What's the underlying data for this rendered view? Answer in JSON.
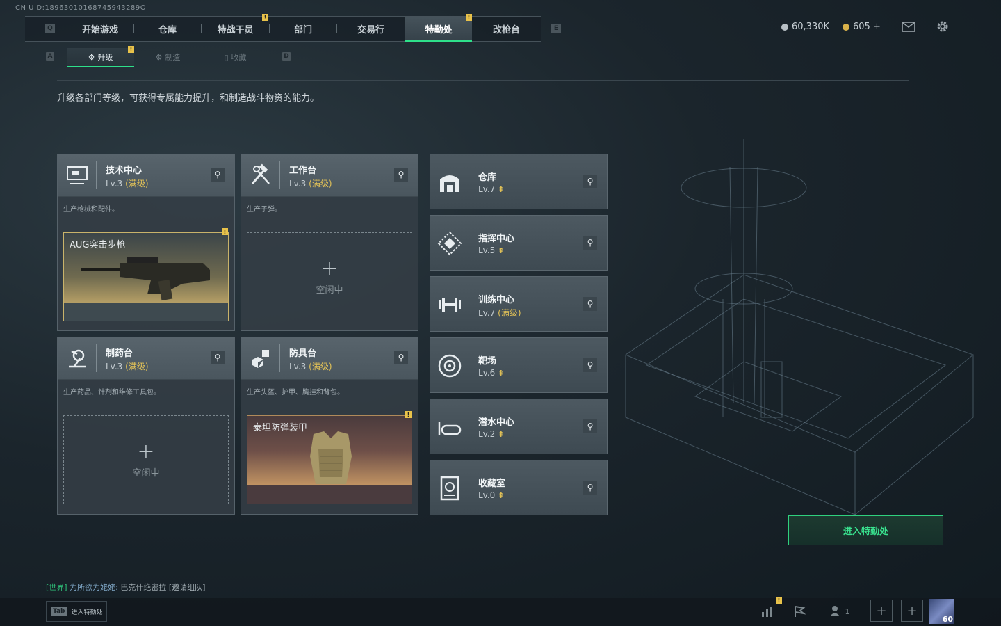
{
  "uid_text": "CN UID:18963010168745943289O",
  "nav": {
    "key_left": "Q",
    "key_right": "E",
    "tabs": [
      {
        "label": "开始游戏"
      },
      {
        "label": "仓库"
      },
      {
        "label": "特战干员"
      },
      {
        "label": "部门"
      },
      {
        "label": "交易行"
      },
      {
        "label": "特勤处"
      },
      {
        "label": "改枪台"
      }
    ]
  },
  "subnav": {
    "key_left": "A",
    "key_right": "D",
    "tabs": [
      {
        "label": "升级"
      },
      {
        "label": "制造"
      },
      {
        "label": "收藏"
      }
    ]
  },
  "currency": {
    "silver": "60,330K",
    "gold": "605 +"
  },
  "description": "升级各部门等级，可获得专属能力提升，和制造战斗物资的能力。",
  "cards": {
    "tech": {
      "name": "技术中心",
      "lv": "Lv.3",
      "max": "(满级)",
      "sub": "生产枪械和配件。",
      "item": "AUG突击步枪"
    },
    "workbench": {
      "name": "工作台",
      "lv": "Lv.3",
      "max": "(满级)",
      "sub": "生产子弹。",
      "idle": "空闲中"
    },
    "pharmacy": {
      "name": "制药台",
      "lv": "Lv.3",
      "max": "(满级)",
      "sub": "生产药品、针剂和维修工具包。",
      "idle": "空闲中"
    },
    "armor": {
      "name": "防具台",
      "lv": "Lv.3",
      "max": "(满级)",
      "sub": "生产头盔、护甲、胸挂和背包。",
      "item": "泰坦防弹装甲"
    }
  },
  "depts": [
    {
      "name": "仓库",
      "lv": "Lv.7",
      "max": ""
    },
    {
      "name": "指挥中心",
      "lv": "Lv.5",
      "max": ""
    },
    {
      "name": "训练中心",
      "lv": "Lv.7",
      "max": "(满级)"
    },
    {
      "name": "靶场",
      "lv": "Lv.6",
      "max": ""
    },
    {
      "name": "潜水中心",
      "lv": "Lv.2",
      "max": ""
    },
    {
      "name": "收藏室",
      "lv": "Lv.0",
      "max": ""
    }
  ],
  "enter_button": "进入特勤处",
  "chat": {
    "tag": "[世界]",
    "user": "为所欲为姥姥:",
    "text": "巴克什绝密拉",
    "invite": "[邀请组队]"
  },
  "tab_hint": {
    "key": "Tab",
    "label": "进入特勤处"
  },
  "bottom": {
    "friends_count": "1",
    "level": "60"
  },
  "alert_glyph": "!",
  "colors": {
    "accent": "#2ee08a",
    "gold": "#e2c257"
  }
}
